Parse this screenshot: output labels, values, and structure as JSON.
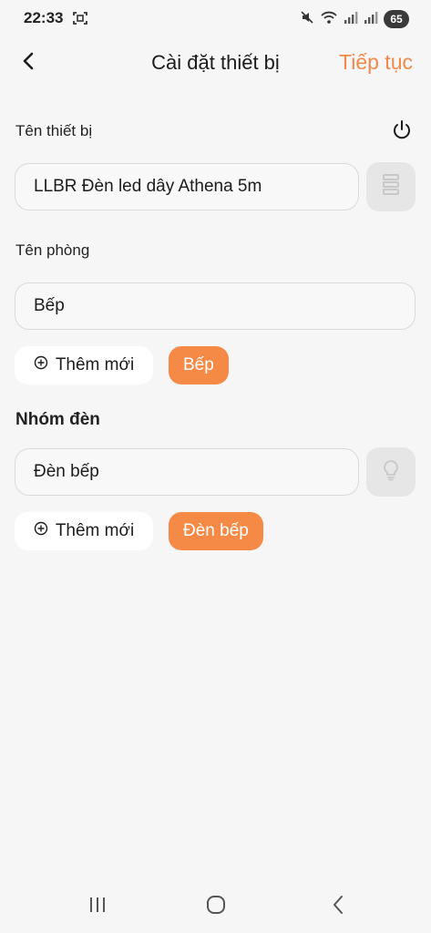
{
  "status_bar": {
    "time": "22:33",
    "battery": "65",
    "icons": [
      "screenshot-icon",
      "mute-icon",
      "wifi-icon",
      "signal-icon",
      "signal-icon",
      "battery-icon"
    ]
  },
  "header": {
    "title": "Cài đặt thiết bị",
    "continue_label": "Tiếp tục",
    "back_icon": "chevron-left-icon"
  },
  "device": {
    "label": "Tên thiết bị",
    "name_value": "LLBR Đèn led dây Athena 5m",
    "power_icon": "power-icon",
    "side_icon": "led-strip-icon"
  },
  "room": {
    "label": "Tên phòng",
    "value": "Bếp",
    "add_label": "Thêm mới",
    "tags": [
      "Bếp"
    ]
  },
  "group": {
    "label": "Nhóm đèn",
    "value": "Đèn bếp",
    "side_icon": "bulb-icon",
    "add_label": "Thêm mới",
    "tags": [
      "Đèn bếp"
    ]
  },
  "colors": {
    "accent": "#f58a47",
    "background": "#f6f6f6",
    "input_border": "#dadada"
  },
  "nav_bar": {
    "icons": [
      "recent-apps-icon",
      "home-icon",
      "back-icon"
    ]
  }
}
